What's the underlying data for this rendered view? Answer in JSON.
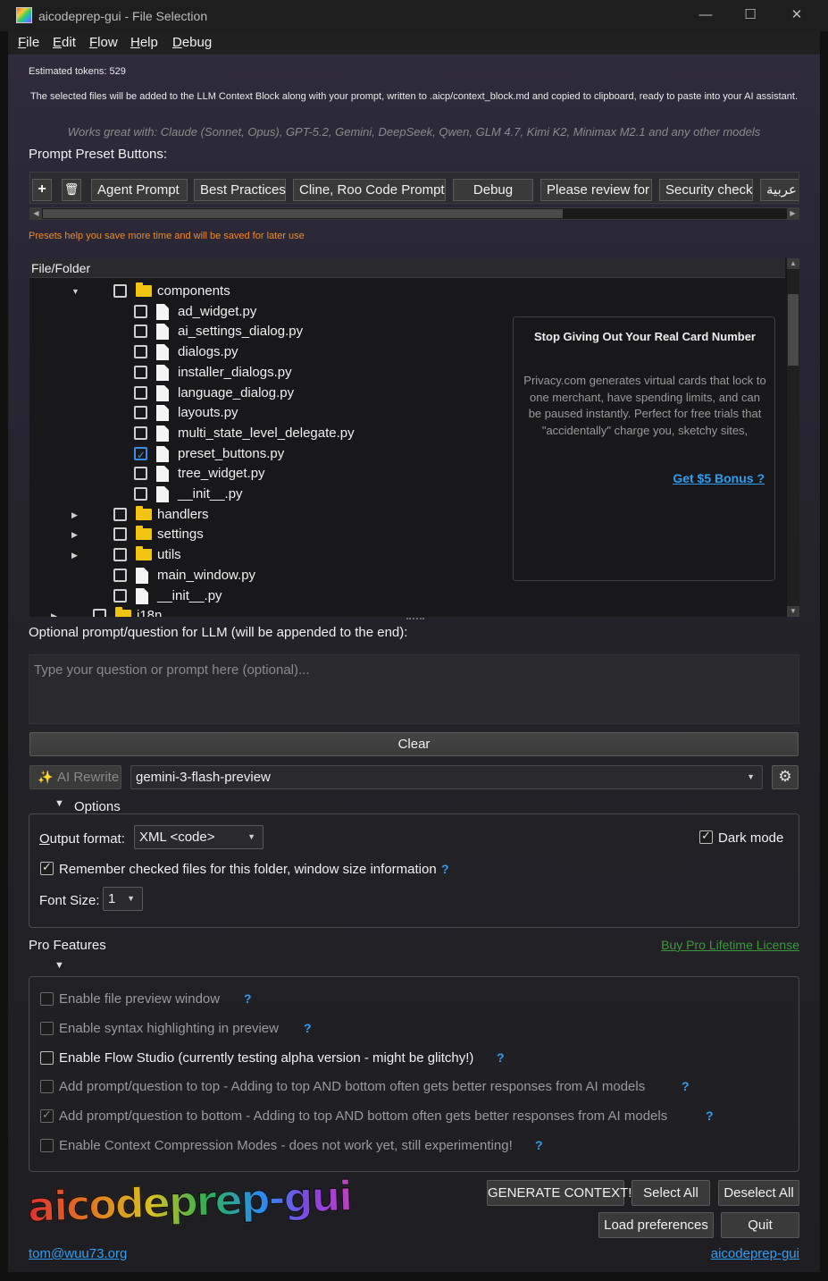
{
  "window": {
    "title": "aicodeprep-gui - File Selection",
    "minimize_glyph": "—",
    "maximize_glyph": "☐",
    "close_glyph": "✕"
  },
  "menu": {
    "items": [
      {
        "accel": "F",
        "rest": "ile"
      },
      {
        "accel": "E",
        "rest": "dit"
      },
      {
        "accel": "F",
        "rest": "low"
      },
      {
        "accel": "H",
        "rest": "elp"
      },
      {
        "accel": "D",
        "rest": "ebug"
      }
    ]
  },
  "header": {
    "estimated_tokens": "Estimated tokens: 529",
    "info_text": "The selected files will be added to the LLM Context Block along with your prompt, written to .aicp/context_block.md and copied to clipboard, ready to paste into your AI assistant.",
    "works_with": "Works great with: Claude (Sonnet, Opus), GPT-5.2, Gemini, DeepSeek, Qwen, GLM 4.7, Kimi K2, Minimax M2.1 and any other models",
    "preset_label": "Prompt Preset Buttons:"
  },
  "presets": {
    "add_glyph": "+",
    "delete_glyph": "🗑",
    "buttons": [
      "Agent Prompt",
      "Best Practices",
      "Cline, Roo Code Prompt",
      "Debug",
      "Please review for",
      "Security check",
      "عربية"
    ],
    "hint": "Presets help you save more time and will be saved for later use"
  },
  "tree": {
    "header": "File/Folder",
    "rows": [
      {
        "name": "components",
        "type": "folder",
        "expanded": true,
        "checked": false
      },
      {
        "name": "ad_widget.py",
        "type": "file",
        "checked": false
      },
      {
        "name": "ai_settings_dialog.py",
        "type": "file",
        "checked": false
      },
      {
        "name": "dialogs.py",
        "type": "file",
        "checked": false
      },
      {
        "name": "installer_dialogs.py",
        "type": "file",
        "checked": false
      },
      {
        "name": "language_dialog.py",
        "type": "file",
        "checked": false
      },
      {
        "name": "layouts.py",
        "type": "file",
        "checked": false
      },
      {
        "name": "multi_state_level_delegate.py",
        "type": "file",
        "checked": false
      },
      {
        "name": "preset_buttons.py",
        "type": "file",
        "checked": true
      },
      {
        "name": "tree_widget.py",
        "type": "file",
        "checked": false
      },
      {
        "name": "__init__.py",
        "type": "file",
        "checked": false
      },
      {
        "name": "handlers",
        "type": "folder",
        "expanded": false,
        "checked": false
      },
      {
        "name": "settings",
        "type": "folder",
        "expanded": false,
        "checked": false
      },
      {
        "name": "utils",
        "type": "folder",
        "expanded": false,
        "checked": false
      },
      {
        "name": "main_window.py",
        "type": "file",
        "checked": false
      },
      {
        "name": "__init__.py",
        "type": "file",
        "checked": false
      },
      {
        "name": "i18n",
        "type": "folder",
        "expanded": false,
        "checked": false
      }
    ]
  },
  "ad": {
    "title": "Stop Giving Out Your Real Card Number",
    "body": "Privacy.com generates virtual cards that lock to one merchant, have spending limits, and can be paused instantly. Perfect for free trials that \"accidentally\" charge you, sketchy sites,",
    "link": "Get $5 Bonus ?"
  },
  "prompt": {
    "label": "Optional prompt/question for LLM (will be appended to the end):",
    "placeholder": "Type your question or prompt here (optional)...",
    "clear_label": "Clear"
  },
  "ai": {
    "rewrite_label": "AI Rewrite",
    "model": "gemini-3-flash-preview"
  },
  "options": {
    "title": "Options",
    "output_format_label": "Output format:",
    "output_format_accel": "O",
    "output_format_value": "XML <code>",
    "dark_mode_label": "Dark mode",
    "dark_mode_checked": true,
    "remember_label": "Remember checked files for this folder, window size information",
    "remember_checked": true,
    "font_size_label": "Font Size:",
    "font_size_value": "1"
  },
  "pro": {
    "title": "Pro Features",
    "buy_link": "Buy Pro Lifetime License",
    "features": [
      {
        "label": "Enable file preview window",
        "checked": false,
        "enabled": false
      },
      {
        "label": "Enable syntax highlighting in preview",
        "checked": false,
        "enabled": false
      },
      {
        "label": "Enable Flow Studio (currently testing alpha version - might be glitchy!)",
        "checked": false,
        "enabled": true
      },
      {
        "label": "Add prompt/question to top - Adding to top AND bottom often gets better responses from AI models",
        "checked": false,
        "enabled": false
      },
      {
        "label": "Add prompt/question to bottom - Adding to top AND bottom often gets better responses from AI models",
        "checked": true,
        "enabled": false
      },
      {
        "label": "Enable Context Compression Modes - does not work yet, still experimenting!",
        "checked": false,
        "enabled": false
      }
    ]
  },
  "actions": {
    "generate": "GENERATE CONTEXT!",
    "select_all": "Select All",
    "deselect_all": "Deselect All",
    "load_prefs": "Load preferences",
    "quit": "Quit"
  },
  "footer": {
    "logo": "aicodeprep-gui",
    "email": "tom@wuu73.org",
    "site_link": "aicodeprep-gui"
  },
  "colors": {
    "accent": "#2e9ef2",
    "folder": "#f2c40f",
    "hint": "#f08a24",
    "buy_link": "#3a9a3a"
  }
}
